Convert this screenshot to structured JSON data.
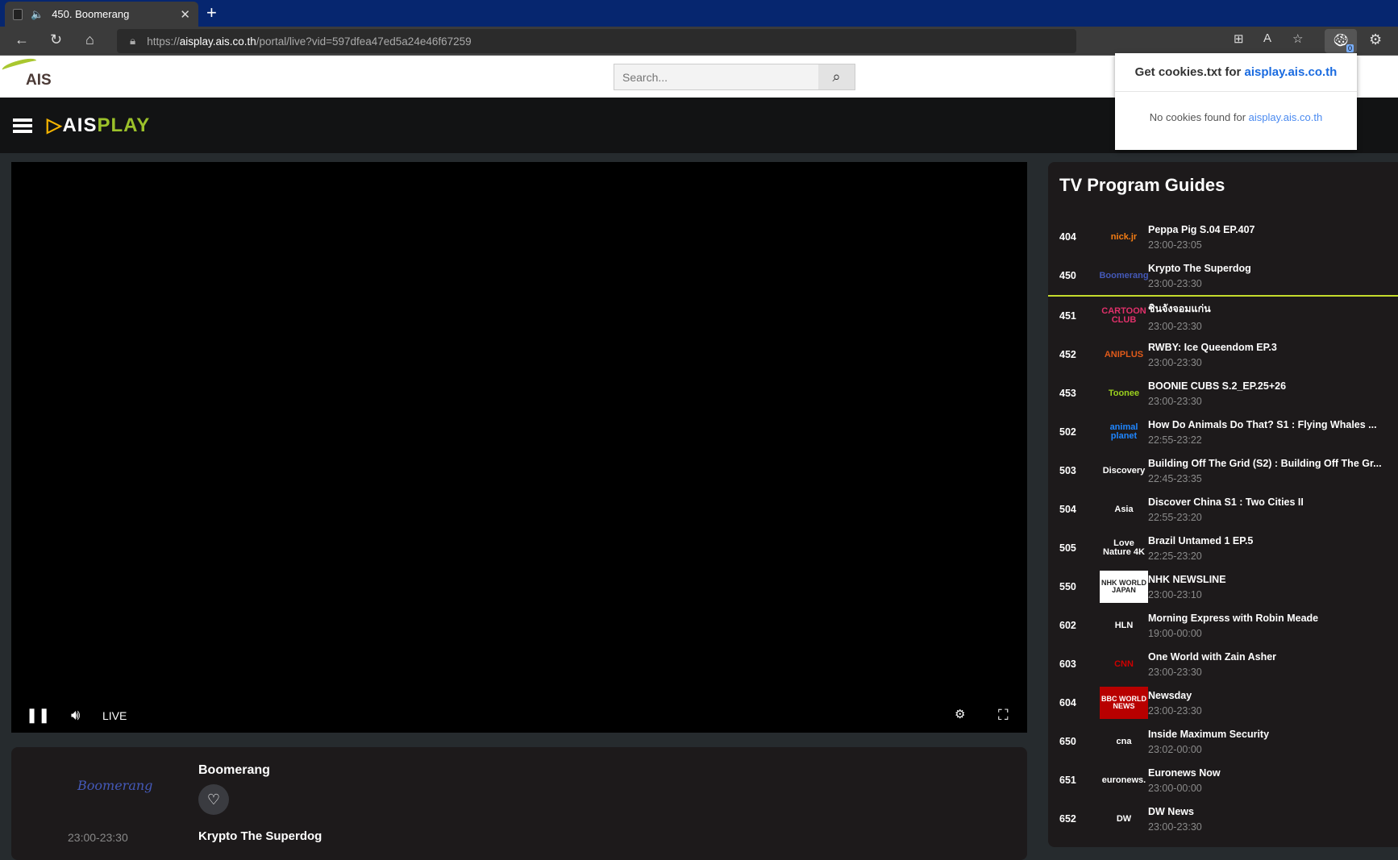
{
  "browser": {
    "tab_title": "450. Boomerang",
    "url_prefix": "https://",
    "url_host": "aisplay.ais.co.th",
    "url_path": "/portal/live?vid=597dfea47ed5a24e46f67259",
    "ext_badge": "0"
  },
  "header": {
    "ais_logo": "AIS",
    "search_placeholder": "Search...",
    "brand_ais": "AIS",
    "brand_play": "PLAY"
  },
  "player": {
    "live_label": "LIVE"
  },
  "info": {
    "channel_logo": "Boomerang",
    "channel_name": "Boomerang",
    "time": "23:00-23:30",
    "program": "Krypto The Superdog"
  },
  "guide": {
    "title": "TV Program Guides",
    "items": [
      {
        "num": "404",
        "logo": "nick.jr",
        "title": "Peppa Pig S.04 EP.407",
        "time": "23:00-23:05",
        "color": "#f57d14"
      },
      {
        "num": "450",
        "logo": "Boomerang",
        "title": "Krypto The Superdog",
        "time": "23:00-23:30",
        "color": "#4459b8"
      },
      {
        "num": "451",
        "logo": "CARTOON CLUB",
        "title": "ชินจังจอมแก่น",
        "time": "23:00-23:30",
        "color": "#e0306a"
      },
      {
        "num": "452",
        "logo": "ANIPLUS",
        "title": "RWBY: Ice Queendom EP.3",
        "time": "23:00-23:30",
        "color": "#e05a1a"
      },
      {
        "num": "453",
        "logo": "Toonee",
        "title": "BOONIE CUBS S.2_EP.25+26",
        "time": "23:00-23:30",
        "color": "#9bd11e"
      },
      {
        "num": "502",
        "logo": "animal planet",
        "title": "How Do Animals Do That? S1 : Flying Whales ...",
        "time": "22:55-23:22",
        "color": "#1f86ff"
      },
      {
        "num": "503",
        "logo": "Discovery",
        "title": "Building Off The Grid (S2) : Building Off The Gr...",
        "time": "22:45-23:35",
        "color": "#ffffff"
      },
      {
        "num": "504",
        "logo": "Asia",
        "title": "Discover China S1 : Two Cities II",
        "time": "22:55-23:20",
        "color": "#ffffff"
      },
      {
        "num": "505",
        "logo": "Love Nature 4K",
        "title": "Brazil Untamed 1 EP.5",
        "time": "22:25-23:20",
        "color": "#ffffff"
      },
      {
        "num": "550",
        "logo": "NHK WORLD JAPAN",
        "title": "NHK NEWSLINE",
        "time": "23:00-23:10",
        "color": "#222222"
      },
      {
        "num": "602",
        "logo": "HLN",
        "title": "Morning Express with Robin Meade",
        "time": "19:00-00:00",
        "color": "#ffffff"
      },
      {
        "num": "603",
        "logo": "CNN",
        "title": "One World with Zain Asher",
        "time": "23:00-23:30",
        "color": "#cc0000"
      },
      {
        "num": "604",
        "logo": "BBC WORLD NEWS",
        "title": "Newsday",
        "time": "23:00-23:30",
        "color": "#ffffff"
      },
      {
        "num": "650",
        "logo": "cna",
        "title": "Inside Maximum Security",
        "time": "23:02-00:00",
        "color": "#ffffff"
      },
      {
        "num": "651",
        "logo": "euronews.",
        "title": "Euronews Now",
        "time": "23:00-00:00",
        "color": "#ffffff"
      },
      {
        "num": "652",
        "logo": "DW",
        "title": "DW News",
        "time": "23:00-23:30",
        "color": "#ffffff"
      }
    ]
  },
  "popup": {
    "title_prefix": "Get cookies.txt for",
    "title_domain": "aisplay.ais.co.th",
    "message_prefix": "No cookies found for",
    "message_domain": "aisplay.ais.co.th"
  }
}
